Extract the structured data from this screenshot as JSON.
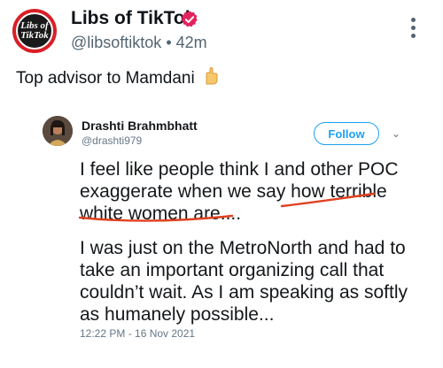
{
  "post": {
    "author_name": "Libs of TikTok",
    "avatar_text_line1": "Libs of",
    "avatar_text_line2": "TikTok",
    "handle": "@libsoftiktok",
    "separator": "•",
    "time_ago": "42m",
    "text": "Top advisor to Mamdani",
    "emoji": "👇",
    "colors": {
      "verified": "#e0245e",
      "avatar_bg": "#d91f26"
    }
  },
  "embedded_tweet": {
    "author_name": "Drashti Brahmbhatt",
    "handle": "@drashti979",
    "follow_label": "Follow",
    "chevron": "⌄",
    "paragraph1": "I feel like people think I and other POC exaggerate when we say how terrible white women are....",
    "paragraph2": "I was just on the MetroNorth and had to take an important organizing call that couldn’t wait. As I am speaking as softly as humanely possible...",
    "timestamp": "12:22 PM - 16 Nov 2021",
    "colors": {
      "follow": "#1da1f2",
      "annotation": "#e0411f"
    }
  },
  "icons": [
    "more-vertical-icon",
    "verified-badge-icon",
    "pointing-hand-emoji"
  ]
}
